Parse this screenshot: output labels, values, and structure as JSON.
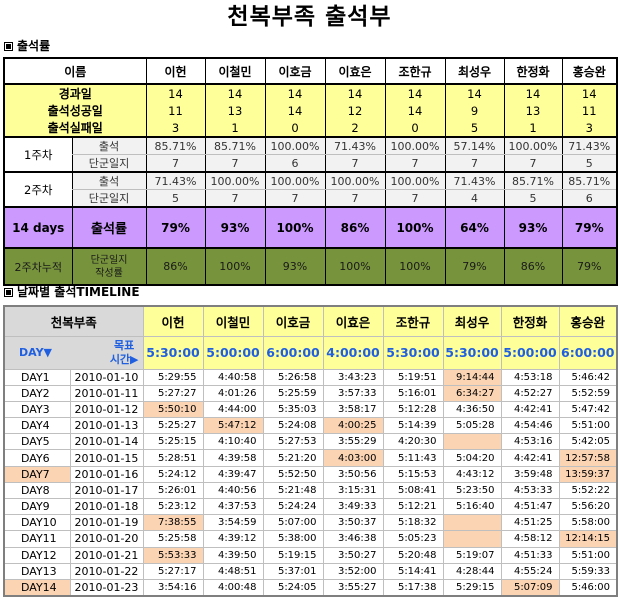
{
  "title": "천복부족 출석부",
  "section1": "출석률",
  "section2": "날짜별 출석TIMELINE",
  "summary": {
    "name_header": "이름",
    "names": [
      "이헌",
      "이철민",
      "이호금",
      "이효은",
      "조한규",
      "최성우",
      "한정화",
      "홍승완"
    ],
    "rows": [
      {
        "label": "경과일",
        "values": [
          "14",
          "14",
          "14",
          "14",
          "14",
          "14",
          "14",
          "14"
        ]
      },
      {
        "label": "출석성공일",
        "values": [
          "11",
          "13",
          "14",
          "12",
          "14",
          "9",
          "13",
          "11"
        ]
      },
      {
        "label": "출석실패일",
        "values": [
          "3",
          "1",
          "0",
          "2",
          "0",
          "5",
          "1",
          "3"
        ]
      }
    ],
    "weeks": [
      {
        "label": "1주차",
        "rows": [
          {
            "label": "출석",
            "values": [
              "85.71%",
              "85.71%",
              "100.00%",
              "71.43%",
              "100.00%",
              "57.14%",
              "100.00%",
              "71.43%"
            ]
          },
          {
            "label": "단군일지",
            "values": [
              "7",
              "7",
              "6",
              "7",
              "7",
              "7",
              "7",
              "5"
            ]
          }
        ]
      },
      {
        "label": "2주차",
        "rows": [
          {
            "label": "출석",
            "values": [
              "71.43%",
              "100.00%",
              "100.00%",
              "100.00%",
              "100.00%",
              "71.43%",
              "85.71%",
              "85.71%"
            ]
          },
          {
            "label": "단군일지",
            "values": [
              "5",
              "7",
              "7",
              "7",
              "7",
              "4",
              "5",
              "6"
            ]
          }
        ]
      }
    ],
    "rate_row": {
      "label1": "14 days",
      "label2": "출석률",
      "values": [
        "79%",
        "93%",
        "100%",
        "86%",
        "100%",
        "64%",
        "93%",
        "79%"
      ]
    },
    "cumulative_row": {
      "label1": "2주차누적",
      "label2": "단군일지\n작성률",
      "values": [
        "86%",
        "100%",
        "93%",
        "100%",
        "100%",
        "79%",
        "86%",
        "79%"
      ]
    }
  },
  "timeline": {
    "corner_title": "천복부족",
    "day_label": "DAY▼",
    "target_label_line1": "목표",
    "target_label_line2": "시간▶",
    "names": [
      "이헌",
      "이철민",
      "이호금",
      "이효은",
      "조한규",
      "최성우",
      "한정화",
      "홍승완"
    ],
    "targets": [
      "5:30:00",
      "5:00:00",
      "6:00:00",
      "4:00:00",
      "5:30:00",
      "5:30:00",
      "5:00:00",
      "6:00:00"
    ],
    "highlight_color": "#fbd4b4",
    "rows": [
      {
        "day": "DAY1",
        "date": "2010-01-10",
        "times": [
          "5:29:55",
          "4:40:58",
          "5:26:58",
          "3:43:23",
          "5:19:51",
          "9:14:44",
          "4:53:18",
          "5:46:42"
        ],
        "late": [
          false,
          false,
          false,
          false,
          false,
          true,
          false,
          false
        ]
      },
      {
        "day": "DAY2",
        "date": "2010-01-11",
        "times": [
          "5:27:27",
          "4:01:26",
          "5:25:59",
          "3:57:33",
          "5:16:01",
          "6:34:27",
          "4:52:27",
          "5:52:59"
        ],
        "late": [
          false,
          false,
          false,
          false,
          false,
          true,
          false,
          false
        ]
      },
      {
        "day": "DAY3",
        "date": "2010-01-12",
        "times": [
          "5:50:10",
          "4:44:00",
          "5:35:03",
          "3:58:17",
          "5:12:28",
          "4:36:50",
          "4:42:41",
          "5:47:42"
        ],
        "late": [
          true,
          false,
          false,
          false,
          false,
          false,
          false,
          false
        ]
      },
      {
        "day": "DAY4",
        "date": "2010-01-13",
        "times": [
          "5:25:27",
          "5:47:12",
          "5:24:08",
          "4:00:25",
          "5:14:39",
          "5:05:28",
          "4:54:46",
          "5:51:00"
        ],
        "late": [
          false,
          true,
          false,
          true,
          false,
          false,
          false,
          false
        ]
      },
      {
        "day": "DAY5",
        "date": "2010-01-14",
        "times": [
          "5:25:15",
          "4:10:40",
          "5:27:53",
          "3:55:29",
          "4:20:30",
          "",
          "4:53:16",
          "5:42:05"
        ],
        "late": [
          false,
          false,
          false,
          false,
          false,
          true,
          false,
          false
        ]
      },
      {
        "day": "DAY6",
        "date": "2010-01-15",
        "times": [
          "5:28:51",
          "4:39:58",
          "5:21:20",
          "4:03:00",
          "5:11:43",
          "5:04:20",
          "4:42:41",
          "12:57:58"
        ],
        "late": [
          false,
          false,
          false,
          true,
          false,
          false,
          false,
          true
        ]
      },
      {
        "day": "DAY7",
        "date": "2010-01-16",
        "times": [
          "5:24:12",
          "4:39:47",
          "5:52:50",
          "3:50:56",
          "5:15:53",
          "4:43:12",
          "3:59:48",
          "13:59:37"
        ],
        "late": [
          false,
          false,
          false,
          false,
          false,
          false,
          false,
          true
        ]
      },
      {
        "day": "DAY8",
        "date": "2010-01-17",
        "times": [
          "5:26:01",
          "4:40:56",
          "5:21:48",
          "3:15:31",
          "5:08:41",
          "5:23:50",
          "4:53:33",
          "5:52:22"
        ],
        "late": [
          false,
          false,
          false,
          false,
          false,
          false,
          false,
          false
        ]
      },
      {
        "day": "DAY9",
        "date": "2010-01-18",
        "times": [
          "5:23:12",
          "4:37:53",
          "5:24:24",
          "3:49:33",
          "5:12:21",
          "5:16:40",
          "4:51:47",
          "5:56:20"
        ],
        "late": [
          false,
          false,
          false,
          false,
          false,
          false,
          false,
          false
        ]
      },
      {
        "day": "DAY10",
        "date": "2010-01-19",
        "times": [
          "7:38:55",
          "3:54:59",
          "5:07:00",
          "3:50:37",
          "5:18:32",
          "",
          "4:51:25",
          "5:58:00"
        ],
        "late": [
          true,
          false,
          false,
          false,
          false,
          true,
          false,
          false
        ]
      },
      {
        "day": "DAY11",
        "date": "2010-01-20",
        "times": [
          "5:25:58",
          "4:39:12",
          "5:38:00",
          "3:46:38",
          "5:05:23",
          "",
          "4:58:12",
          "12:14:15"
        ],
        "late": [
          false,
          false,
          false,
          false,
          false,
          true,
          false,
          true
        ]
      },
      {
        "day": "DAY12",
        "date": "2010-01-21",
        "times": [
          "5:53:33",
          "4:39:50",
          "5:19:15",
          "3:50:27",
          "5:20:48",
          "5:19:07",
          "4:51:33",
          "5:51:00"
        ],
        "late": [
          true,
          false,
          false,
          false,
          false,
          false,
          false,
          false
        ]
      },
      {
        "day": "DAY13",
        "date": "2010-01-22",
        "times": [
          "5:27:17",
          "4:48:51",
          "5:37:01",
          "3:52:00",
          "5:14:41",
          "4:28:44",
          "4:55:24",
          "5:59:33"
        ],
        "late": [
          false,
          false,
          false,
          false,
          false,
          false,
          false,
          false
        ]
      },
      {
        "day": "DAY14",
        "date": "2010-01-23",
        "times": [
          "3:54:16",
          "4:00:48",
          "5:24:05",
          "3:55:27",
          "5:17:38",
          "5:29:15",
          "5:07:09",
          "5:46:00"
        ],
        "late": [
          false,
          false,
          false,
          false,
          false,
          false,
          true,
          false
        ]
      }
    ],
    "highlight_days": [
      "DAY7",
      "DAY14"
    ]
  }
}
